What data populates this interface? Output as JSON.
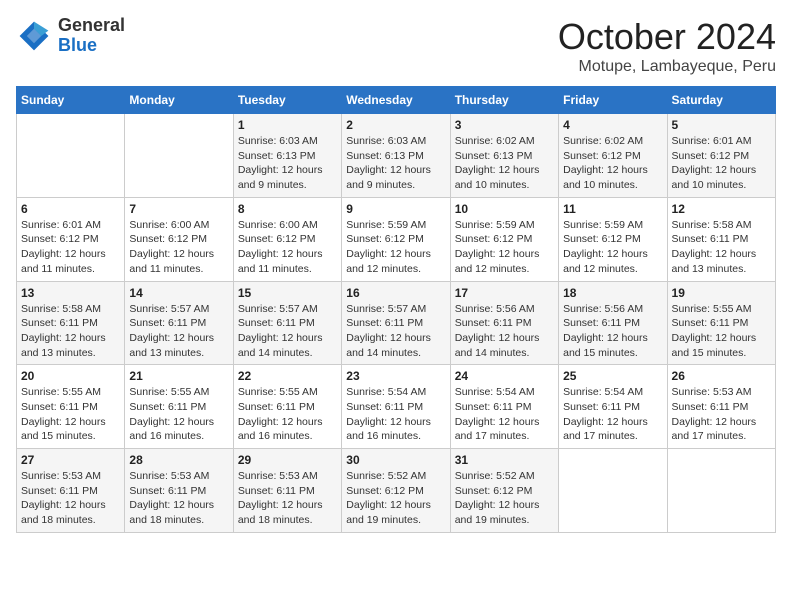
{
  "logo": {
    "general": "General",
    "blue": "Blue"
  },
  "title": "October 2024",
  "location": "Motupe, Lambayeque, Peru",
  "weekdays": [
    "Sunday",
    "Monday",
    "Tuesday",
    "Wednesday",
    "Thursday",
    "Friday",
    "Saturday"
  ],
  "weeks": [
    [
      {
        "day": "",
        "info": ""
      },
      {
        "day": "",
        "info": ""
      },
      {
        "day": "1",
        "info": "Sunrise: 6:03 AM\nSunset: 6:13 PM\nDaylight: 12 hours and 9 minutes."
      },
      {
        "day": "2",
        "info": "Sunrise: 6:03 AM\nSunset: 6:13 PM\nDaylight: 12 hours and 9 minutes."
      },
      {
        "day": "3",
        "info": "Sunrise: 6:02 AM\nSunset: 6:13 PM\nDaylight: 12 hours and 10 minutes."
      },
      {
        "day": "4",
        "info": "Sunrise: 6:02 AM\nSunset: 6:12 PM\nDaylight: 12 hours and 10 minutes."
      },
      {
        "day": "5",
        "info": "Sunrise: 6:01 AM\nSunset: 6:12 PM\nDaylight: 12 hours and 10 minutes."
      }
    ],
    [
      {
        "day": "6",
        "info": "Sunrise: 6:01 AM\nSunset: 6:12 PM\nDaylight: 12 hours and 11 minutes."
      },
      {
        "day": "7",
        "info": "Sunrise: 6:00 AM\nSunset: 6:12 PM\nDaylight: 12 hours and 11 minutes."
      },
      {
        "day": "8",
        "info": "Sunrise: 6:00 AM\nSunset: 6:12 PM\nDaylight: 12 hours and 11 minutes."
      },
      {
        "day": "9",
        "info": "Sunrise: 5:59 AM\nSunset: 6:12 PM\nDaylight: 12 hours and 12 minutes."
      },
      {
        "day": "10",
        "info": "Sunrise: 5:59 AM\nSunset: 6:12 PM\nDaylight: 12 hours and 12 minutes."
      },
      {
        "day": "11",
        "info": "Sunrise: 5:59 AM\nSunset: 6:12 PM\nDaylight: 12 hours and 12 minutes."
      },
      {
        "day": "12",
        "info": "Sunrise: 5:58 AM\nSunset: 6:11 PM\nDaylight: 12 hours and 13 minutes."
      }
    ],
    [
      {
        "day": "13",
        "info": "Sunrise: 5:58 AM\nSunset: 6:11 PM\nDaylight: 12 hours and 13 minutes."
      },
      {
        "day": "14",
        "info": "Sunrise: 5:57 AM\nSunset: 6:11 PM\nDaylight: 12 hours and 13 minutes."
      },
      {
        "day": "15",
        "info": "Sunrise: 5:57 AM\nSunset: 6:11 PM\nDaylight: 12 hours and 14 minutes."
      },
      {
        "day": "16",
        "info": "Sunrise: 5:57 AM\nSunset: 6:11 PM\nDaylight: 12 hours and 14 minutes."
      },
      {
        "day": "17",
        "info": "Sunrise: 5:56 AM\nSunset: 6:11 PM\nDaylight: 12 hours and 14 minutes."
      },
      {
        "day": "18",
        "info": "Sunrise: 5:56 AM\nSunset: 6:11 PM\nDaylight: 12 hours and 15 minutes."
      },
      {
        "day": "19",
        "info": "Sunrise: 5:55 AM\nSunset: 6:11 PM\nDaylight: 12 hours and 15 minutes."
      }
    ],
    [
      {
        "day": "20",
        "info": "Sunrise: 5:55 AM\nSunset: 6:11 PM\nDaylight: 12 hours and 15 minutes."
      },
      {
        "day": "21",
        "info": "Sunrise: 5:55 AM\nSunset: 6:11 PM\nDaylight: 12 hours and 16 minutes."
      },
      {
        "day": "22",
        "info": "Sunrise: 5:55 AM\nSunset: 6:11 PM\nDaylight: 12 hours and 16 minutes."
      },
      {
        "day": "23",
        "info": "Sunrise: 5:54 AM\nSunset: 6:11 PM\nDaylight: 12 hours and 16 minutes."
      },
      {
        "day": "24",
        "info": "Sunrise: 5:54 AM\nSunset: 6:11 PM\nDaylight: 12 hours and 17 minutes."
      },
      {
        "day": "25",
        "info": "Sunrise: 5:54 AM\nSunset: 6:11 PM\nDaylight: 12 hours and 17 minutes."
      },
      {
        "day": "26",
        "info": "Sunrise: 5:53 AM\nSunset: 6:11 PM\nDaylight: 12 hours and 17 minutes."
      }
    ],
    [
      {
        "day": "27",
        "info": "Sunrise: 5:53 AM\nSunset: 6:11 PM\nDaylight: 12 hours and 18 minutes."
      },
      {
        "day": "28",
        "info": "Sunrise: 5:53 AM\nSunset: 6:11 PM\nDaylight: 12 hours and 18 minutes."
      },
      {
        "day": "29",
        "info": "Sunrise: 5:53 AM\nSunset: 6:11 PM\nDaylight: 12 hours and 18 minutes."
      },
      {
        "day": "30",
        "info": "Sunrise: 5:52 AM\nSunset: 6:12 PM\nDaylight: 12 hours and 19 minutes."
      },
      {
        "day": "31",
        "info": "Sunrise: 5:52 AM\nSunset: 6:12 PM\nDaylight: 12 hours and 19 minutes."
      },
      {
        "day": "",
        "info": ""
      },
      {
        "day": "",
        "info": ""
      }
    ]
  ]
}
